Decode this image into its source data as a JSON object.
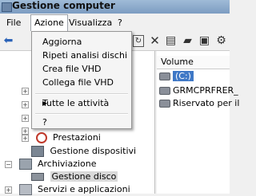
{
  "window": {
    "title": "Gestione computer"
  },
  "menubar": {
    "items": [
      "File",
      "Azione",
      "Visualizza",
      "?"
    ]
  },
  "action_menu": {
    "items": [
      "Aggiorna",
      "Ripeti analisi dischi",
      "Crea file VHD",
      "Collega file VHD",
      "Tutte le attività",
      "?"
    ]
  },
  "tree": {
    "items": [
      "Prestazioni",
      "Gestione dispositivi",
      "Archiviazione",
      "Gestione disco",
      "Servizi e applicazioni"
    ]
  },
  "volume_panel": {
    "column_header": "Volume",
    "rows": [
      "(C:)",
      "GRMCPRFRER_",
      "Riservato per il"
    ]
  },
  "colors": {
    "title_bar": "#8fadd0",
    "selection": "#3f78c6"
  }
}
